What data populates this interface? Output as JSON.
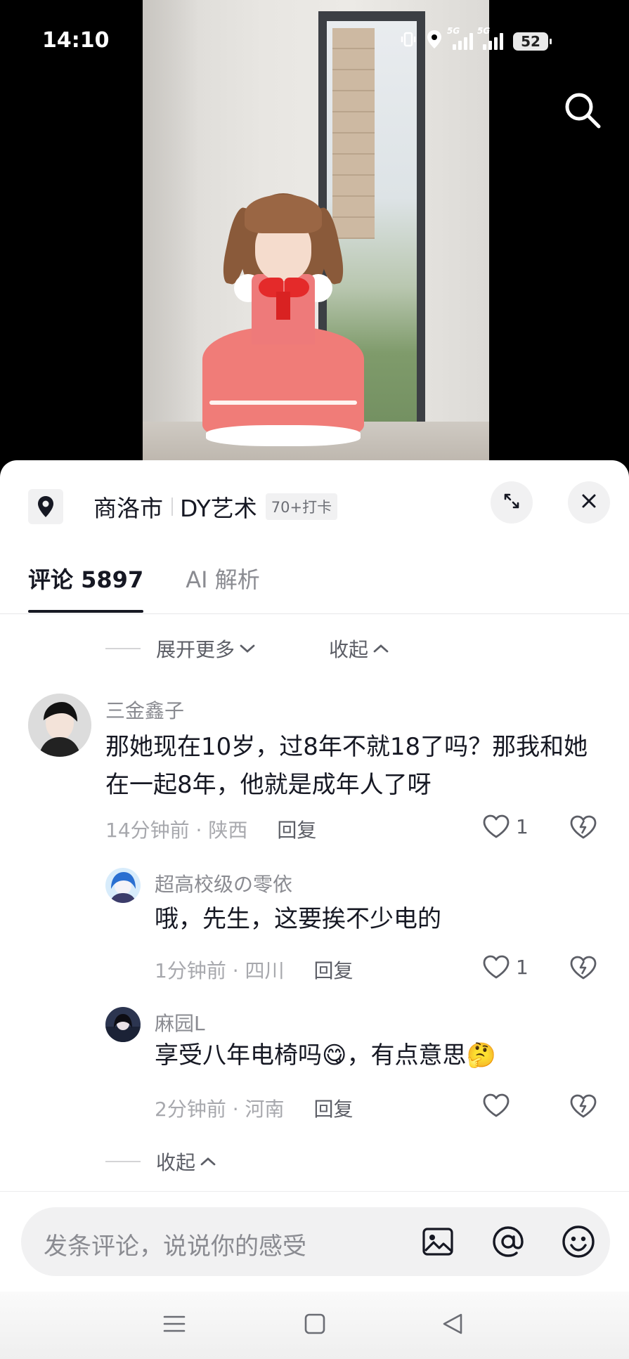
{
  "status_bar": {
    "time": "14:10",
    "sim1_label": "5G",
    "sim2_label": "5G",
    "battery": "52"
  },
  "video": {
    "search_icon": "search-icon"
  },
  "location": {
    "icon": "location-pin-icon",
    "city": "商洛市",
    "place": "DY艺术",
    "badge": "70+打卡"
  },
  "tabs": [
    {
      "label": "评论 5897",
      "active": true
    },
    {
      "label": "AI 解析",
      "active": false
    }
  ],
  "expand": {
    "more_label": "展开更多",
    "collapse_label": "收起"
  },
  "comments": [
    {
      "name": "三金鑫子",
      "text": "那她现在10岁，过8年不就18了吗？那我和她在一起8年，他就是成年人了呀",
      "time": "14分钟前 · 陕西",
      "reply": "回复",
      "likes": "1"
    },
    {
      "name": "超高校级の零依",
      "text": "哦，先生，这要挨不少电的",
      "time": "1分钟前 · 四川",
      "reply": "回复",
      "likes": "1"
    },
    {
      "name": "麻园L",
      "text_before": "享受八年电椅吗",
      "text_middle": "，有点意思",
      "emoji1": "😋",
      "emoji2": "🤔",
      "time": "2分钟前 · 河南",
      "reply": "回复",
      "likes": ""
    }
  ],
  "collapse_bottom": "收起",
  "input": {
    "placeholder": "发条评论，说说你的感受"
  },
  "colors": {
    "text_primary": "#161823",
    "text_secondary": "#8a8b91",
    "panel_bg": "#ffffff",
    "chip_bg": "#f1f1f2"
  }
}
